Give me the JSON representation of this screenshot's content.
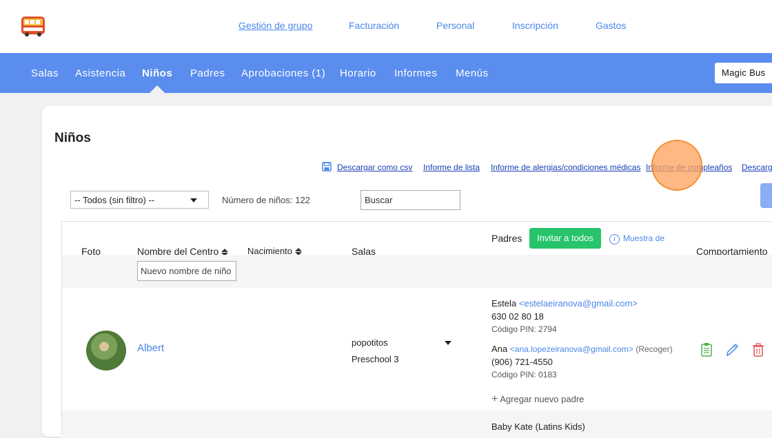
{
  "topnav": {
    "links": [
      "Gestión de grupo",
      "Facturación",
      "Personal",
      "Inscripción",
      "Gastos"
    ]
  },
  "mainnav": {
    "items": [
      "Salas",
      "Asistencia",
      "Niños",
      "Padres",
      "Aprobaciones (1)",
      "Horario",
      "Informes",
      "Menús"
    ],
    "active": "Niños",
    "center_name": "Magic Bus"
  },
  "page": {
    "title": "Niños",
    "reports": [
      "Descargar como csv",
      "Informe de lista",
      "Informe de alergias/condiciones médicas",
      "Informe de cumpleaños",
      "Descarga"
    ],
    "filter_value": "-- Todos (sin filtro) --",
    "count_text": "Número de niños: 122",
    "search_placeholder": "Buscar"
  },
  "table": {
    "headers": {
      "photo": "Foto",
      "name": "Nombre del Centro",
      "birth": "Nacimiento",
      "rooms": "Salas",
      "parents": "Padres",
      "behavior": "Comportamiento"
    },
    "invite_label": "Invitar a todos",
    "sample_label": "Muestra de",
    "name_filter_placeholder": "Nuevo nombre de niño",
    "rows": [
      {
        "name": "Albert",
        "room_selected": "popotitos",
        "room_second": "Preschool 3",
        "parents": [
          {
            "name": "Estela",
            "email": "<estelaeiranova@gmail.com>",
            "phone": "630 02 80 18",
            "pin": "Código PIN: 2794",
            "note": ""
          },
          {
            "name": "Ana",
            "email": "<ana.lopezeiranova@gmail.com>",
            "phone": "(906) 721-4550",
            "pin": "Código PIN: 0183",
            "note": "(Recoger)"
          }
        ],
        "add_parent": "Agregar nuevo padre"
      },
      {
        "parent_preview": "Baby Kate (Latins Kids)"
      }
    ]
  },
  "colors": {
    "nav": "#5b8def",
    "link": "#4a86e8",
    "invite": "#27c46b"
  },
  "icons": [
    "bus-logo-icon",
    "floppy-disk-icon",
    "info-icon",
    "clipboard-icon",
    "pencil-icon",
    "trash-icon",
    "plus-icon"
  ]
}
